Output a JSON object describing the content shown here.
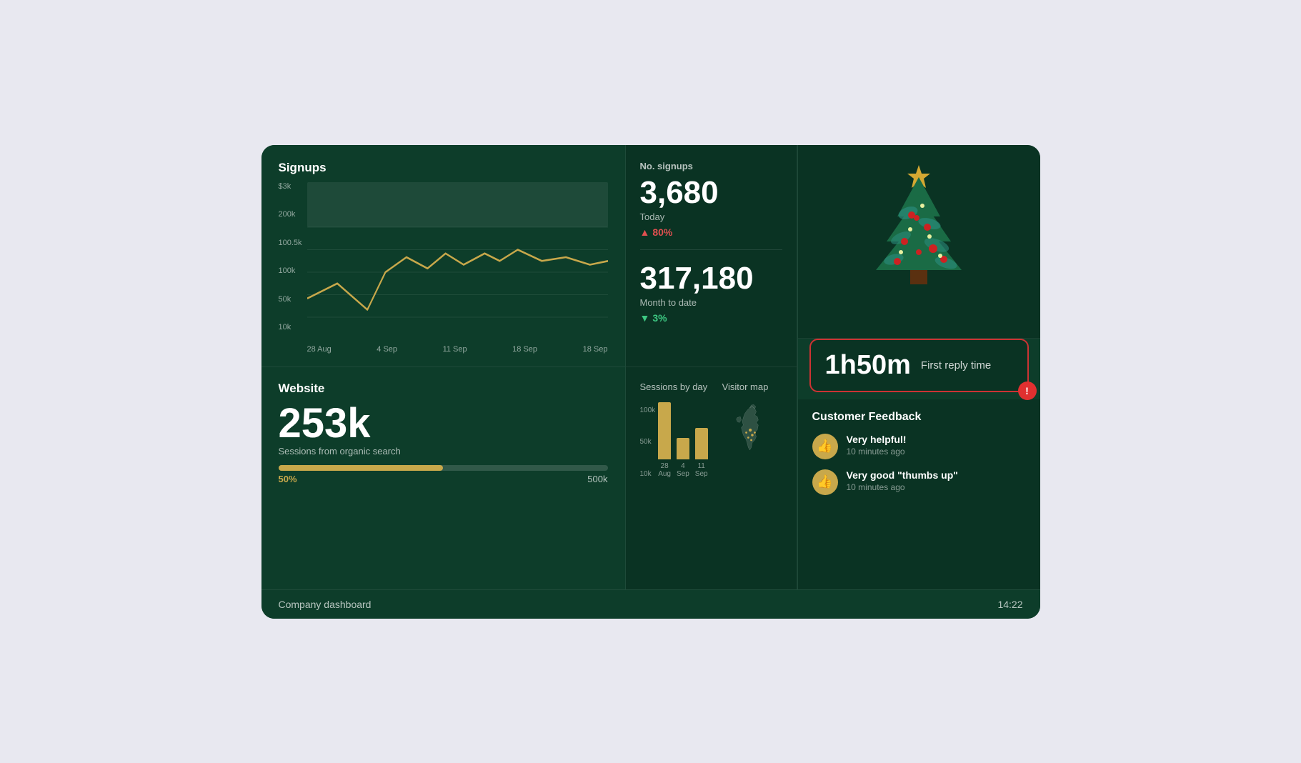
{
  "dashboard": {
    "title": "Company dashboard",
    "time": "14:22",
    "bg_color": "#0d3d2a"
  },
  "signups": {
    "title": "Signups",
    "y_labels": [
      "$3k",
      "200k",
      "100.5k",
      "100k",
      "50k",
      "10k"
    ],
    "x_labels": [
      "28 Aug",
      "4 Sep",
      "11 Sep",
      "18 Sep",
      "18 Sep"
    ],
    "line_color": "#c8a84b"
  },
  "no_signups": {
    "label": "No. signups",
    "today_value": "3,680",
    "today_label": "Today",
    "today_trend": "80%",
    "today_trend_dir": "up",
    "mtd_value": "317,180",
    "mtd_label": "Month to date",
    "mtd_trend": "3%",
    "mtd_trend_dir": "down"
  },
  "website": {
    "title": "Website",
    "sessions_value": "253k",
    "sessions_label": "Sessions from organic search",
    "progress_pct": "50%",
    "progress_max": "500k",
    "progress_fill_pct": 50
  },
  "sessions_by_day": {
    "title": "Sessions by day",
    "y_labels": [
      "100k",
      "50k",
      "10k"
    ],
    "bars": [
      {
        "label": "28 Aug",
        "height_pct": 95
      },
      {
        "label": "4 Sep",
        "height_pct": 38
      },
      {
        "label": "11 Sep",
        "height_pct": 55
      }
    ]
  },
  "visitor_map": {
    "title": "Visitor map"
  },
  "reply_time": {
    "value": "1h50m",
    "label": "First reply time",
    "alert": "!"
  },
  "customer_feedback": {
    "title": "Customer Feedback",
    "items": [
      {
        "text": "Very helpful!",
        "time": "10 minutes ago",
        "icon": "👍"
      },
      {
        "text": "Very good \"thumbs up\"",
        "time": "10 minutes ago",
        "icon": "👍"
      }
    ]
  }
}
